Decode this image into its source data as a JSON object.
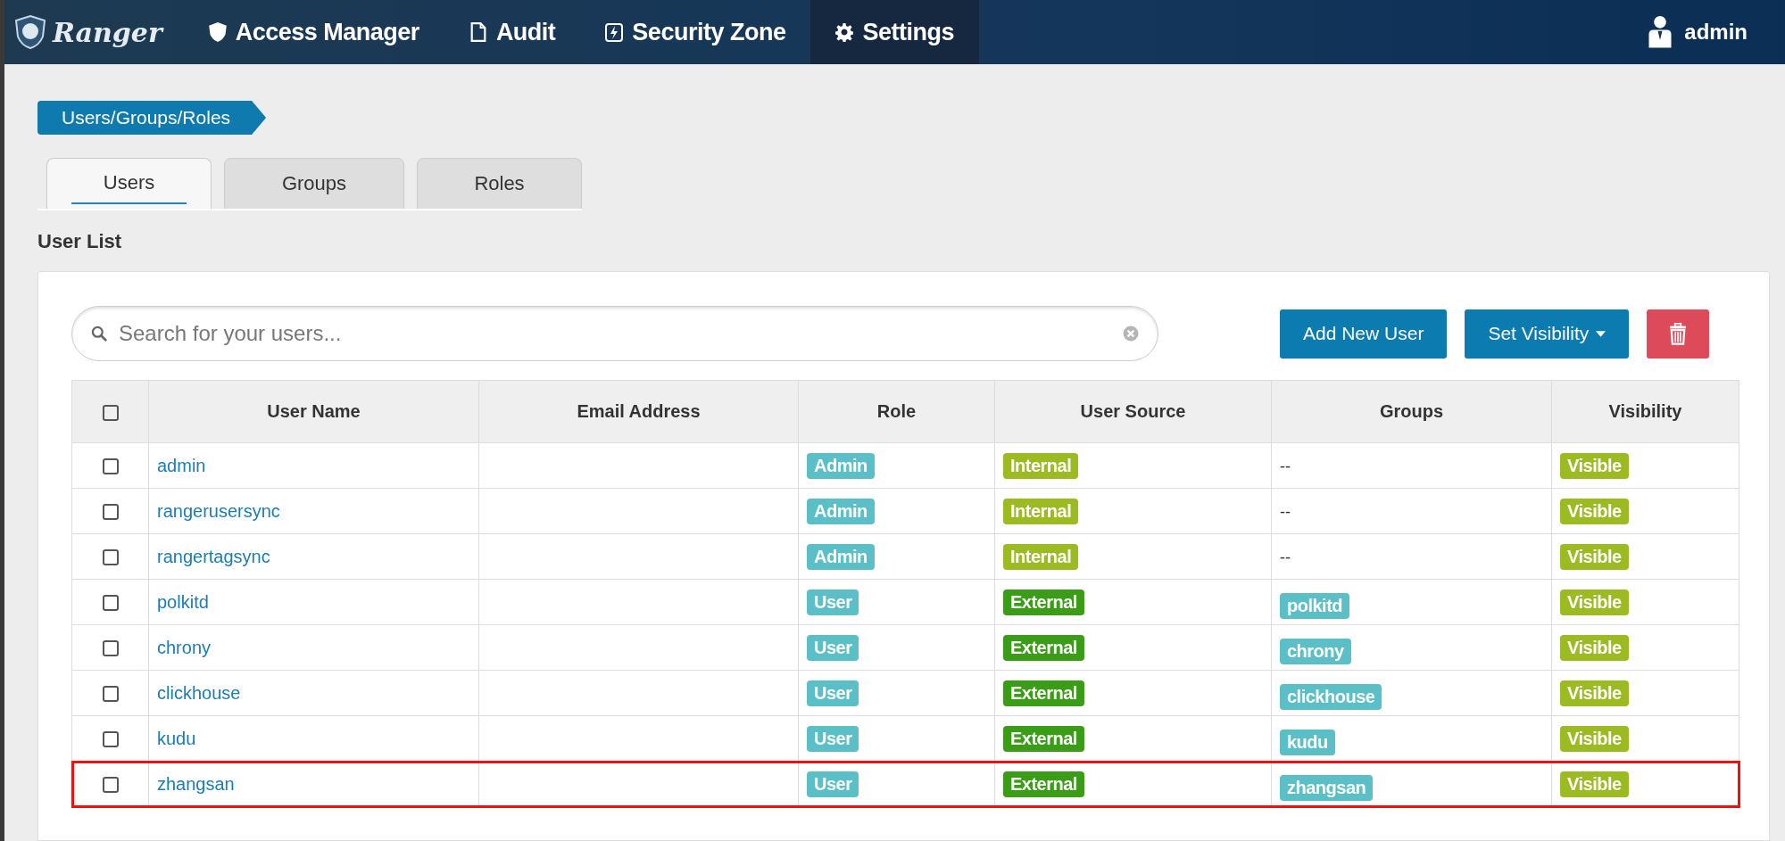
{
  "navbar": {
    "brand": "Ranger",
    "items": [
      {
        "label": "Access Manager",
        "selected": false
      },
      {
        "label": "Audit",
        "selected": false
      },
      {
        "label": "Security Zone",
        "selected": false
      },
      {
        "label": "Settings",
        "selected": true
      }
    ],
    "user": "admin"
  },
  "breadcrumb": "Users/Groups/Roles",
  "tabs": [
    {
      "label": "Users",
      "selected": true
    },
    {
      "label": "Groups",
      "selected": false
    },
    {
      "label": "Roles",
      "selected": false
    }
  ],
  "section_title": "User List",
  "search": {
    "placeholder": "Search for your users..."
  },
  "buttons": {
    "add": "Add New User",
    "visibility": "Set Visibility"
  },
  "table": {
    "header_checked": false,
    "columns": [
      "User Name",
      "Email Address",
      "Role",
      "User Source",
      "Groups",
      "Visibility"
    ],
    "rows": [
      {
        "checked": false,
        "highlighted": false,
        "name": "admin",
        "role": "Admin",
        "source": {
          "text": "Internal",
          "kind": "internal"
        },
        "groups": [],
        "groups_text": "--",
        "visibility": "Visible"
      },
      {
        "checked": false,
        "highlighted": false,
        "name": "rangerusersync",
        "role": "Admin",
        "source": {
          "text": "Internal",
          "kind": "internal"
        },
        "groups": [],
        "groups_text": "--",
        "visibility": "Visible"
      },
      {
        "checked": false,
        "highlighted": false,
        "name": "rangertagsync",
        "role": "Admin",
        "source": {
          "text": "Internal",
          "kind": "internal"
        },
        "groups": [],
        "groups_text": "--",
        "visibility": "Visible"
      },
      {
        "checked": false,
        "highlighted": false,
        "name": "polkitd",
        "role": "User",
        "source": {
          "text": "External",
          "kind": "external"
        },
        "groups": [
          "polkitd"
        ],
        "visibility": "Visible"
      },
      {
        "checked": false,
        "highlighted": false,
        "name": "chrony",
        "role": "User",
        "source": {
          "text": "External",
          "kind": "external"
        },
        "groups": [
          "chrony"
        ],
        "visibility": "Visible"
      },
      {
        "checked": false,
        "highlighted": false,
        "name": "clickhouse",
        "role": "User",
        "source": {
          "text": "External",
          "kind": "external"
        },
        "groups": [
          "clickhouse"
        ],
        "visibility": "Visible"
      },
      {
        "checked": false,
        "highlighted": false,
        "name": "kudu",
        "role": "User",
        "source": {
          "text": "External",
          "kind": "external"
        },
        "groups": [
          "kudu"
        ],
        "visibility": "Visible"
      },
      {
        "checked": false,
        "highlighted": true,
        "name": "zhangsan",
        "role": "User",
        "source": {
          "text": "External",
          "kind": "external"
        },
        "groups": [
          "zhangsan"
        ],
        "visibility": "Visible"
      }
    ]
  }
}
